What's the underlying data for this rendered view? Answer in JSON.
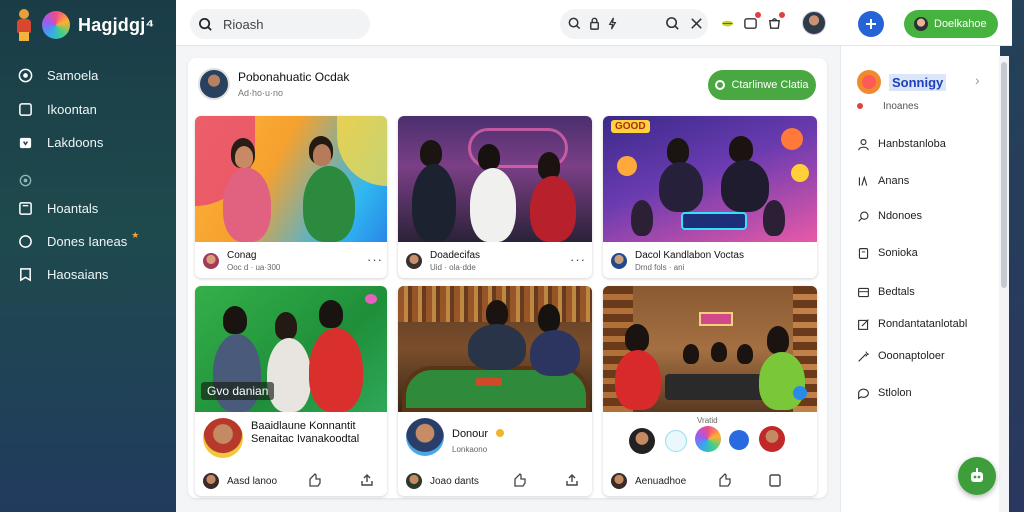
{
  "app": {
    "brand": "Hagjdgj⁴"
  },
  "sidebar": {
    "items": [
      {
        "label": "Samoela",
        "icon": "circle-check-icon"
      },
      {
        "label": "Ikoontan",
        "icon": "square-icon"
      },
      {
        "label": "Lakdoons",
        "icon": "gift-icon"
      },
      {
        "label": "",
        "icon": "pin-icon"
      },
      {
        "label": "Hoantals",
        "icon": "book-icon"
      },
      {
        "label": "Dones Ianeas",
        "icon": "ring-icon"
      },
      {
        "label": "Haosaians",
        "icon": "bookmark-icon"
      }
    ]
  },
  "topbar": {
    "search_placeholder": "Rioash"
  },
  "right": {
    "green_button": "Doelkahoe",
    "panel_title": "Sonnigy",
    "panel_sub": "Inoanes",
    "items": [
      {
        "label": "Hanbstanloba",
        "icon": "person-icon"
      },
      {
        "label": "Anans",
        "icon": "vertical-lines-icon"
      },
      {
        "label": "Ndonoes",
        "icon": "search-icon"
      },
      {
        "label": "Sonioka",
        "icon": "document-icon"
      },
      {
        "label": "Bedtals",
        "icon": "grid-icon"
      },
      {
        "label": "Rondantatanlotabl",
        "icon": "edit-icon"
      },
      {
        "label": "Ooonaptoloer",
        "icon": "wand-icon"
      },
      {
        "label": "Stlolon",
        "icon": "chat-icon"
      }
    ]
  },
  "feed": {
    "title": "Pobonahuatic Ocdak",
    "meta": "Ad·ho·u·no",
    "join_button": "Ctarlinwe Clatia",
    "cards": [
      {
        "label": "Conag",
        "sub": "Ooc d · ua·300"
      },
      {
        "label": "Doadecifas",
        "sub": "Uid · ola·dde"
      },
      {
        "label": "Dacol Kandlabon Voctas",
        "sub": "Dmd fols · ani"
      },
      {
        "overlay": "Gvo danian",
        "text1": "Baaidlaune Konnantit",
        "text2": "Senaitac Ivanakoodtal",
        "foot": "Aasd lanoo"
      },
      {
        "label": "Donour",
        "sub": "Lonkaono",
        "foot": "Joao dants"
      },
      {
        "label": "Vratid",
        "foot": "Aenuadhoe"
      }
    ],
    "card3_badge": "GOOD",
    "colors": {
      "accent_green": "#4aa843",
      "accent_blue": "#2563d6"
    }
  }
}
